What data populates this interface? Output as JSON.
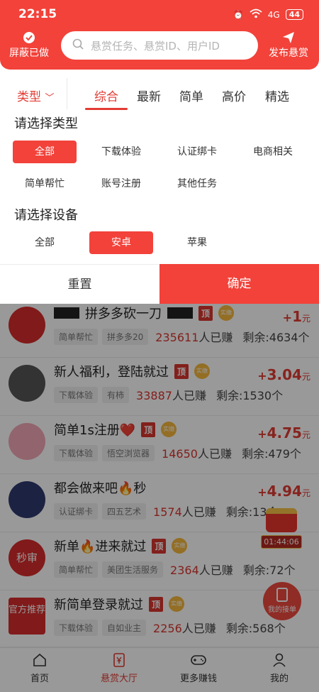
{
  "status_bar": {
    "time": "22:15",
    "network": "4G",
    "battery": "44"
  },
  "header": {
    "block_label": "屏蔽已做",
    "search_placeholder": "悬赏任务、悬赏ID、用户ID",
    "publish_label": "发布悬赏"
  },
  "filter": {
    "type_label": "类型",
    "tabs": [
      "综合",
      "最新",
      "简单",
      "高价",
      "精选"
    ],
    "type_section": "请选择类型",
    "type_options": [
      "全部",
      "下载体验",
      "认证绑卡",
      "电商相关",
      "简单帮忙",
      "账号注册",
      "其他任务"
    ],
    "device_section": "请选择设备",
    "device_options": [
      "全部",
      "安卓",
      "苹果"
    ],
    "reset": "重置",
    "confirm": "确定"
  },
  "list": [
    {
      "title": "拼多多砍一刀",
      "tag1": "简单帮忙",
      "tag2": "拼多多20",
      "earned_num": "235611",
      "earned_unit": "人已赚",
      "remain": "剩余:4634个",
      "price_int": "1",
      "price_dec": "",
      "avatar_color": "#d72c2c"
    },
    {
      "title": "新人福利，登陆就过",
      "tag1": "下载体验",
      "tag2": "有柿",
      "earned_num": "33887",
      "earned_unit": "人已赚",
      "remain": "剩余:1530个",
      "price_int": "3",
      "price_dec": ".04",
      "avatar_color": "#3b3b3b"
    },
    {
      "title": "简单1s注册❤️",
      "tag1": "下载体验",
      "tag2": "悟空浏览器",
      "earned_num": "14650",
      "earned_unit": "人已赚",
      "remain": "剩余:479个",
      "price_int": "4",
      "price_dec": ".75",
      "avatar_color": "#f3a7b6"
    },
    {
      "title": "都会做来吧🔥秒",
      "tag1": "认证绑卡",
      "tag2": "四五艺术",
      "earned_num": "1574",
      "earned_unit": "人已赚",
      "remain": "剩余:13个",
      "price_int": "4",
      "price_dec": ".94",
      "avatar_color": "#2f3a6e"
    },
    {
      "title": "新单🔥进来就过",
      "tag1": "简单帮忙",
      "tag2": "美团生活服务",
      "earned_num": "2364",
      "earned_unit": "人已赚",
      "remain": "剩余:72个",
      "price_int": "",
      "price_dec": "",
      "avatar_color": "#d72c2c",
      "avatar_text": "秒审"
    },
    {
      "title": "新简单登录就过",
      "tag1": "下载体验",
      "tag2": "自如业主",
      "earned_num": "2256",
      "earned_unit": "人已赚",
      "remain": "剩余:568个",
      "price_int": "",
      "price_dec": "",
      "avatar_color": "#d72c2c",
      "avatar_text": "官方推荐"
    }
  ],
  "badges": {
    "top": "顶",
    "medal": "实缴"
  },
  "float": {
    "timer": "01:44:06",
    "my_orders": "我的接单"
  },
  "nav": [
    "首页",
    "悬赏大厅",
    "更多赚钱",
    "我的"
  ],
  "colors": {
    "accent": "#f2423a",
    "price": "#e23b33"
  }
}
